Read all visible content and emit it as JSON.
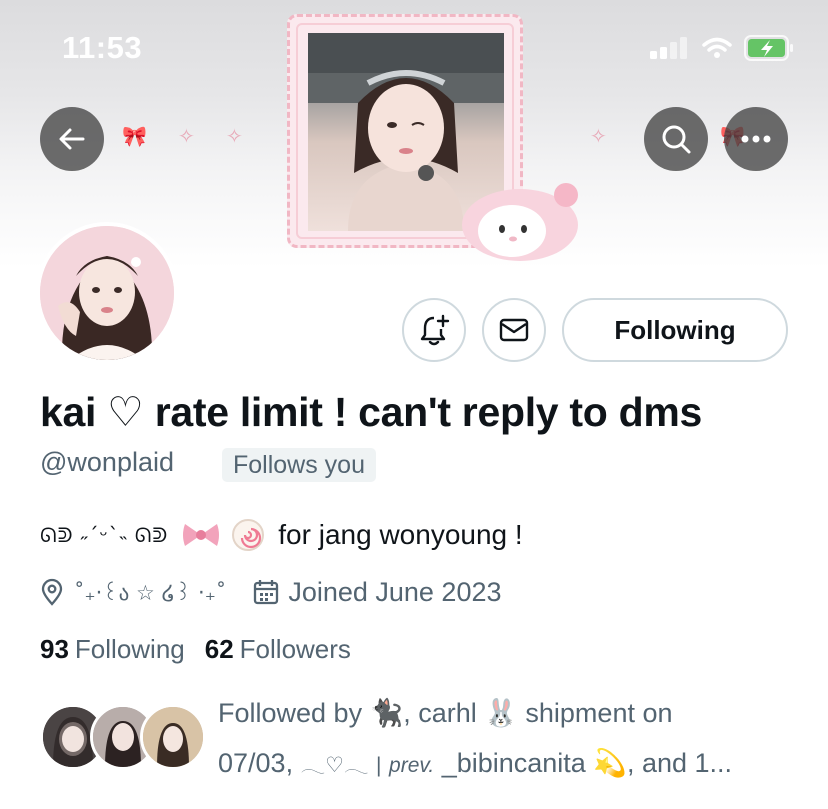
{
  "status_bar": {
    "time": "11:53"
  },
  "banner": {
    "deco_bow": "🎀",
    "deco_sparkle": "✧"
  },
  "profile": {
    "display_name": "kai ♡ rate limit ! can't reply to dms",
    "handle": "@wonplaid",
    "follows_you": "Follows you",
    "bio": {
      "kaomoji": "ᘏᕲ ˶ˊᵕˋ˵ ᘏᕲ",
      "bow_emoji": "🎀",
      "fishcake_emoji": "🍥",
      "text": "for jang wonyoung !"
    },
    "location": "˚₊‧꒰ა ☆ ໒꒱ ‧₊˚",
    "joined": "Joined June 2023",
    "following_count": "93",
    "following_label": "Following",
    "followers_count": "62",
    "followers_label": "Followers"
  },
  "actions": {
    "following_button": "Following"
  },
  "followed_by": {
    "prefix": "Followed by",
    "cat_emoji": "🐈‍⬛",
    "name2": ", carhl",
    "rabbit_emoji": "🐰",
    "name2_suffix": "shipment on",
    "line2_start": "07/03,",
    "wing_deco": "𓂃♡𓂃",
    "prev_sep": "|",
    "prev_label": "prev.",
    "name3": "_bibincanita",
    "star_emoji": "💫",
    "tail": ", and 1..."
  },
  "icons": {
    "back": "arrow-left-icon",
    "search": "search-icon",
    "more": "more-horizontal-icon",
    "notify": "bell-plus-icon",
    "message": "envelope-icon",
    "location": "location-pin-icon",
    "calendar": "calendar-icon",
    "signal": "signal-icon",
    "wifi": "wifi-icon",
    "battery": "battery-icon"
  },
  "colors": {
    "text_primary": "#0f1419",
    "text_secondary": "#536471",
    "border": "#cfd9de",
    "nav_button": "#444444",
    "battery": "#65c466"
  }
}
